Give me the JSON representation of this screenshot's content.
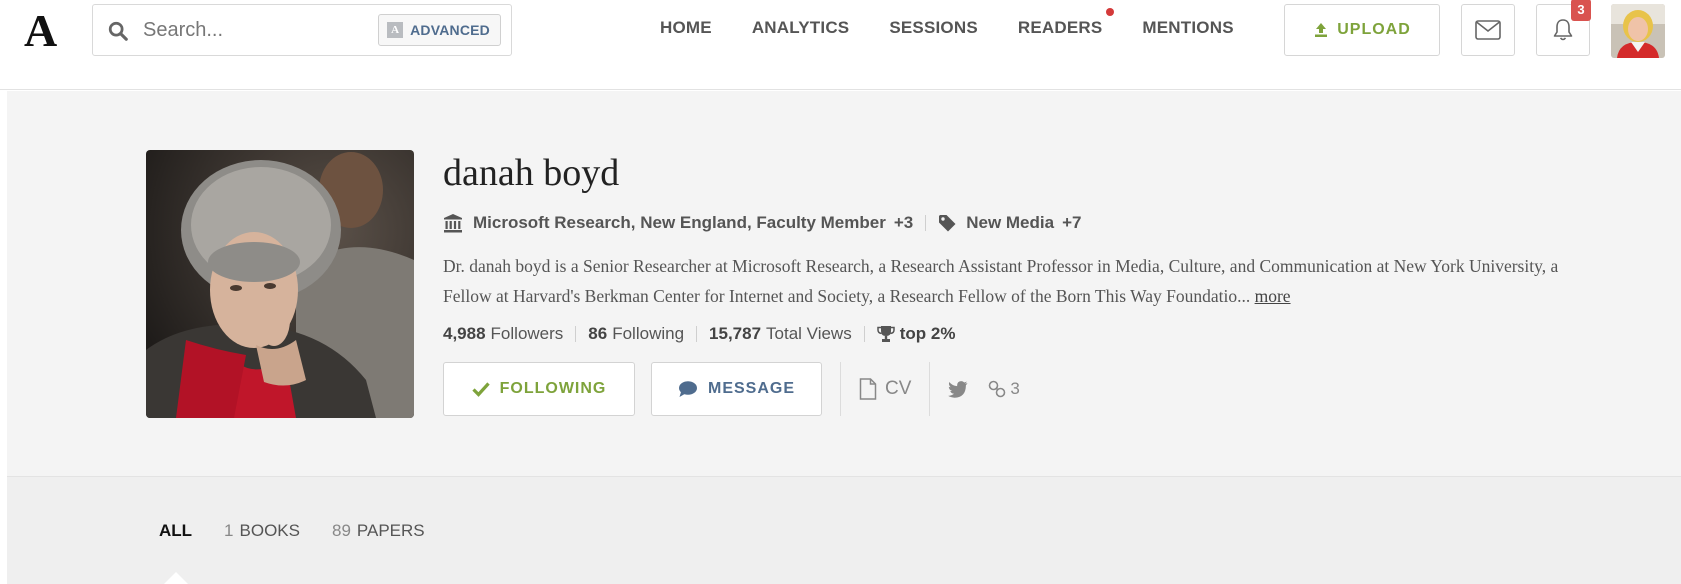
{
  "header": {
    "logo": "A",
    "search": {
      "placeholder": "Search...",
      "advanced_label": "ADVANCED",
      "advanced_icon_letter": "A"
    },
    "nav": [
      {
        "label": "HOME",
        "has_dot": false
      },
      {
        "label": "ANALYTICS",
        "has_dot": false
      },
      {
        "label": "SESSIONS",
        "has_dot": false
      },
      {
        "label": "READERS",
        "has_dot": true
      },
      {
        "label": "MENTIONS",
        "has_dot": false
      }
    ],
    "upload_label": "UPLOAD",
    "notifications_count": "3"
  },
  "profile": {
    "name": "danah boyd",
    "affiliation": "Microsoft Research, New England, Faculty Member",
    "affiliation_more": "+3",
    "interest": "New Media",
    "interest_more": "+7",
    "bio": "Dr. danah boyd is a Senior Researcher at Microsoft Research, a Research Assistant Professor in Media, Culture, and Communication at New York University, a Fellow at Harvard's Berkman Center for Internet and Society, a Research Fellow of the Born This Way Foundatio...",
    "bio_more": "more",
    "stats": {
      "followers_count": "4,988",
      "followers_label": "Followers",
      "following_count": "86",
      "following_label": "Following",
      "views_count": "15,787",
      "views_label": "Total Views",
      "rank": "top 2%"
    },
    "actions": {
      "following_label": "FOLLOWING",
      "message_label": "MESSAGE",
      "cv_label": "CV",
      "links_count": "3"
    }
  },
  "tabs": [
    {
      "label": "ALL",
      "count": "",
      "active": true
    },
    {
      "label": "BOOKS",
      "count": "1",
      "active": false
    },
    {
      "label": "PAPERS",
      "count": "89",
      "active": false
    }
  ],
  "colors": {
    "accent_green": "#7ea33b",
    "accent_blue": "#4f6c8e",
    "badge_red": "#d9534f",
    "band_bg": "#f4f4f4"
  }
}
